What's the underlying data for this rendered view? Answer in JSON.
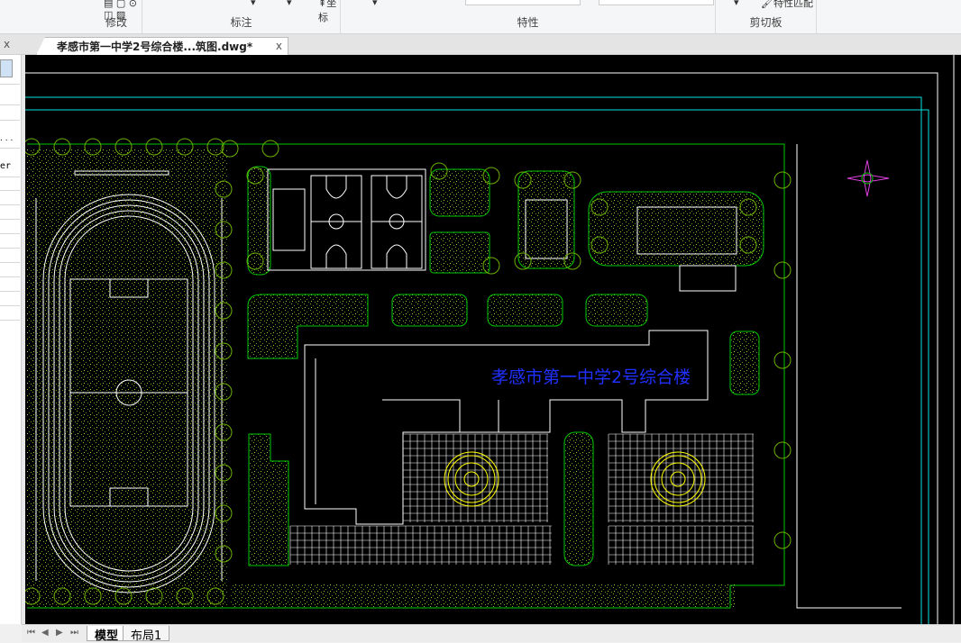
{
  "ribbon": {
    "groups": [
      {
        "label": "修改"
      },
      {
        "label": "标注"
      },
      {
        "label": "特性"
      },
      {
        "label": "剪切板"
      }
    ],
    "coord_label": "坐标",
    "match_props_label": "特性匹配"
  },
  "document": {
    "tab_title": "孝感市第一中学2号综合楼...筑图.dwg*",
    "close": "x"
  },
  "left_panel": {
    "close": "x",
    "row_text": "er",
    "dots": ". . ."
  },
  "drawing": {
    "building_label": "孝感市第一中学2号综合楼"
  },
  "bottom": {
    "tabs": [
      {
        "label": "模型",
        "active": true
      },
      {
        "label": "布局1",
        "active": false
      }
    ],
    "nav": [
      "⏮",
      "◀",
      "▶",
      "⏭"
    ]
  },
  "colors": {
    "canvas": "#000000",
    "green": "#00c800",
    "cyan": "#00e0e0",
    "yellow": "#ffff00",
    "blue_text": "#2030ff",
    "hatch": "#6fb020"
  }
}
